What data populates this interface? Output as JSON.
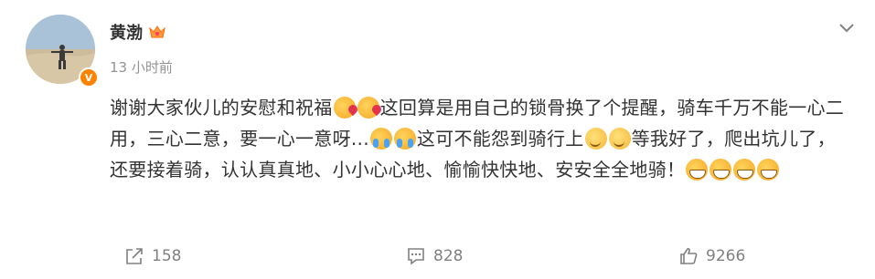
{
  "post": {
    "author": "黄渤",
    "time": "13 小时前",
    "text": [
      "谢谢大家伙儿的安慰和祝福",
      "这回算是用自己的锁骨换了个提醒，骑车千万不能一心二用，三心二意，要一心一意呀...",
      "这可不能怨到骑行上",
      "等我好了，爬出坑儿了，还要接着骑，认认真真地、小小心心地、愉愉快快地、安安全全地骑！"
    ],
    "emojis": [
      "blush-heart-emoji",
      "cry-emoji",
      "think-emoji",
      "grin-emoji"
    ]
  },
  "actions": {
    "repost": "158",
    "comment": "828",
    "like": "9266"
  },
  "colors": {
    "vip_orange": "#ff8200",
    "text": "#333333",
    "meta": "#939393"
  }
}
